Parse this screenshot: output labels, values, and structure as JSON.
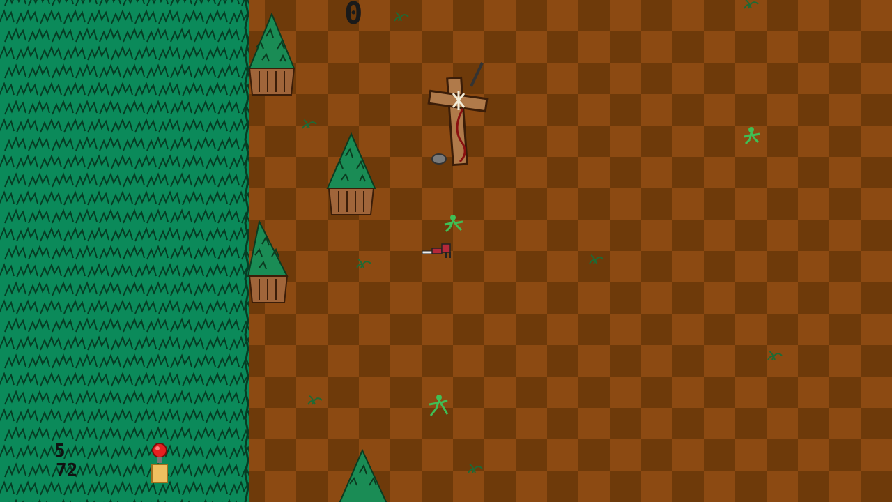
{
  "hud": {
    "score": "0",
    "stat_a": "5",
    "stat_b": "72"
  },
  "colors": {
    "forest": "#0b8a5a",
    "ground_light": "#8c4a12",
    "ground_dark": "#6e3a0a",
    "tree_foliage": "#1a8c55",
    "trunk": "#a0653a",
    "enemy": "#3fbf55"
  },
  "sprites": {
    "player": "player-character",
    "cross": "wooden-cross-grave",
    "enemies": [
      "green-goblin",
      "green-goblin",
      "green-goblin"
    ],
    "pickup": "health-potion-item"
  }
}
